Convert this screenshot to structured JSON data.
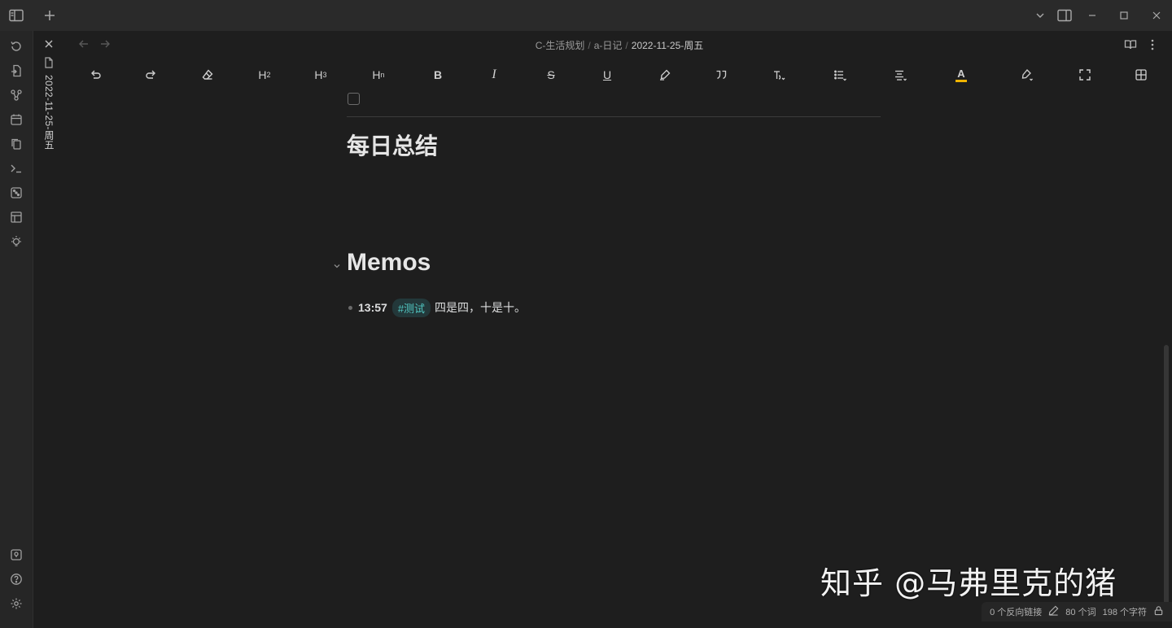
{
  "tab": {
    "title": "2022-11-25-周五"
  },
  "breadcrumb": {
    "part1": "C-生活规划",
    "sep": "/",
    "part2": "a-日记",
    "current": "2022-11-25-周五"
  },
  "toolbar": {
    "h2": "H",
    "h2_sub": "2",
    "h3": "H",
    "h3_sub": "3",
    "hn": "H",
    "hn_sub": "n",
    "bold": "B",
    "italic": "I",
    "strike": "S",
    "underline": "U",
    "font_color": "A"
  },
  "colors": {
    "font_color_underline": "#f0b400",
    "tag_text": "#52c8c3",
    "tag_bg": "#23383a"
  },
  "content": {
    "heading_daily": "每日总结",
    "heading_memos": "Memos",
    "memo": {
      "time": "13:57",
      "tag": "#测试",
      "text": "四是四，十是十。"
    }
  },
  "watermark": "知乎 @马弗里克的猪",
  "status": {
    "backlinks": "0 个反向链接",
    "words": "80 个词",
    "chars": "198 个字符"
  },
  "icons": {
    "ribbon": [
      "history-icon",
      "file-import-icon",
      "graph-icon",
      "calendar-icon",
      "copy-icon",
      "terminal-icon",
      "dice-icon",
      "layout-icon",
      "lightbulb-icon"
    ],
    "ribbon_bottom": [
      "vault-icon",
      "help-icon",
      "settings-icon"
    ]
  }
}
